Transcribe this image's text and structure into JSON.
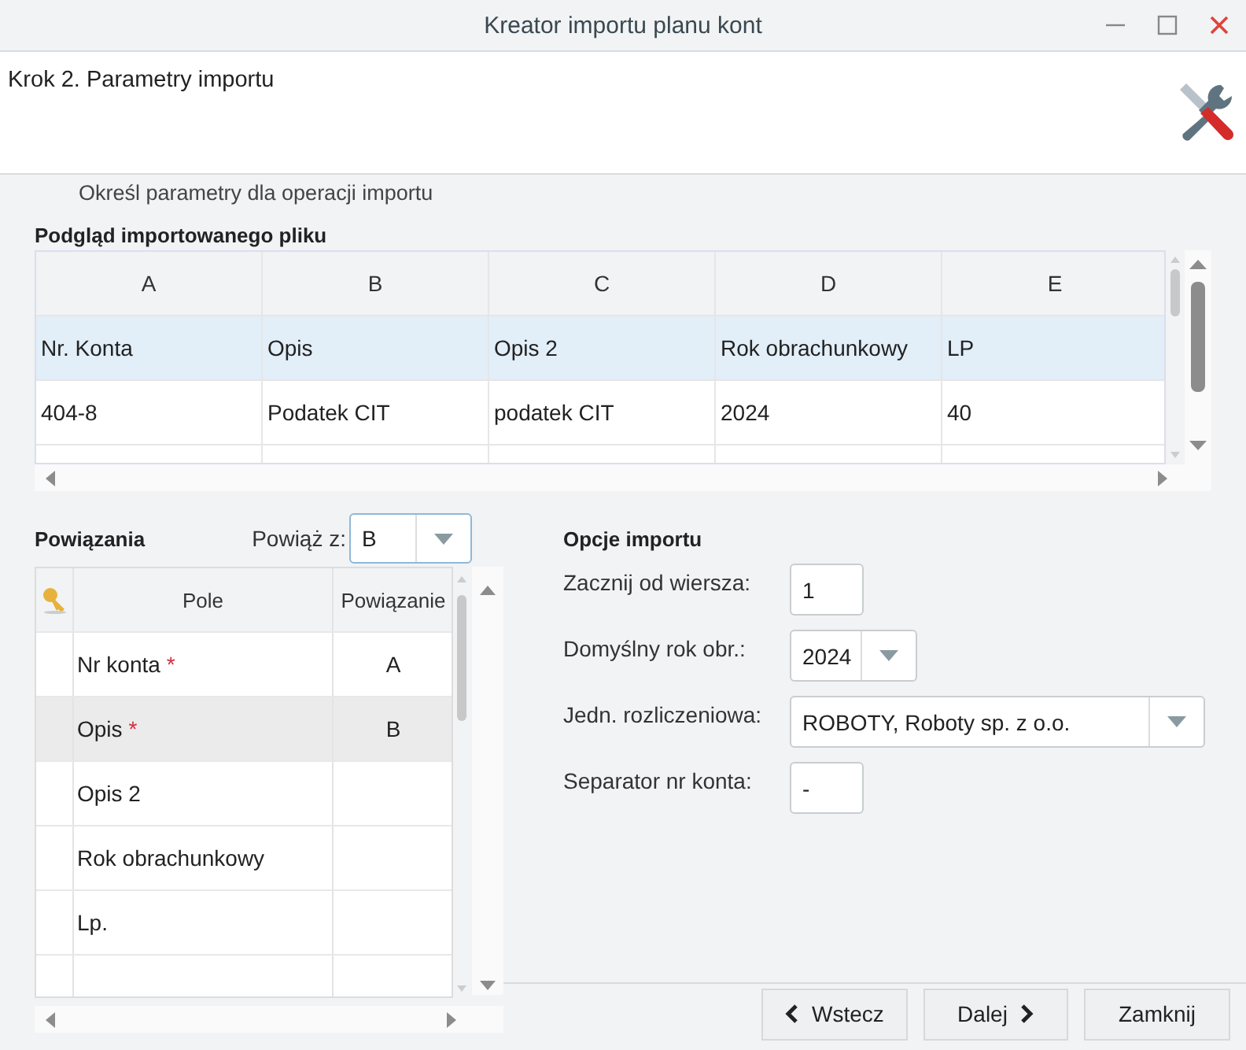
{
  "window": {
    "title": "Kreator importu planu kont"
  },
  "header": {
    "step": "Krok 2. Parametry importu",
    "description": "Określ parametry dla operacji importu"
  },
  "preview": {
    "title": "Podgląd importowanego pliku",
    "columns": [
      "A",
      "B",
      "C",
      "D",
      "E"
    ],
    "rows": [
      {
        "cells": [
          "Nr. Konta",
          "Opis",
          "Opis 2",
          "Rok obrachunkowy",
          "LP"
        ],
        "selected": true
      },
      {
        "cells": [
          "404-8",
          "Podatek CIT",
          "podatek CIT",
          "2024",
          "40"
        ],
        "selected": false
      }
    ]
  },
  "bindings": {
    "title": "Powiązania",
    "bind_label": "Powiąż z:",
    "bind_value": "B",
    "columns": [
      "Pole",
      "Powiązanie"
    ],
    "rows": [
      {
        "field": "Nr konta",
        "required": true,
        "binding": "A",
        "selected": false
      },
      {
        "field": "Opis",
        "required": true,
        "binding": "B",
        "selected": true
      },
      {
        "field": "Opis 2",
        "required": false,
        "selected": false
      },
      {
        "field": "Rok obrachunkowy",
        "required": false,
        "selected": false
      },
      {
        "field": "Lp.",
        "required": false,
        "selected": false
      }
    ],
    "required_mark": "*"
  },
  "options": {
    "title": "Opcje importu",
    "fields": [
      {
        "kind": "input",
        "label": "Zacznij od wiersza:",
        "value": "1"
      },
      {
        "kind": "select",
        "label": "Domyślny rok obr.:",
        "value": "2024"
      },
      {
        "kind": "wide-select",
        "label": "Jedn. rozliczeniowa:",
        "value": "ROBOTY, Roboty sp. z o.o."
      },
      {
        "kind": "input",
        "label": "Separator nr konta:",
        "value": "-"
      }
    ]
  },
  "buttons": [
    {
      "kind": "back",
      "label": "Wstecz"
    },
    {
      "kind": "next",
      "label": "Dalej"
    },
    {
      "kind": "plain",
      "label": "Zamknij"
    }
  ]
}
